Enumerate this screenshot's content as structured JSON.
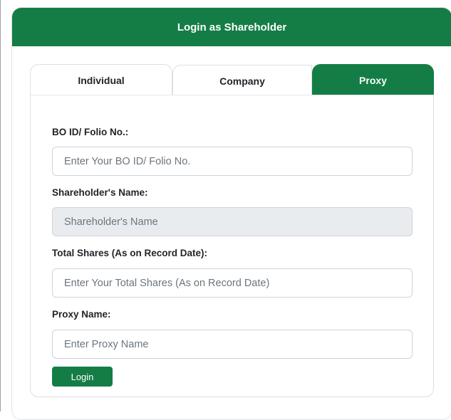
{
  "header": {
    "title": "Login as Shareholder"
  },
  "tabs": [
    {
      "label": "Individual",
      "active": false
    },
    {
      "label": "Company",
      "active": false
    },
    {
      "label": "Proxy",
      "active": true
    }
  ],
  "form": {
    "bo_id": {
      "label": "BO ID/ Folio No.:",
      "placeholder": "Enter Your BO ID/ Folio No.",
      "value": ""
    },
    "shareholder_name": {
      "label": "Shareholder's Name:",
      "placeholder": "Shareholder's Name",
      "value": "",
      "readonly": true
    },
    "total_shares": {
      "label": "Total Shares (As on Record Date):",
      "placeholder": "Enter Your Total Shares (As on Record Date)",
      "value": ""
    },
    "proxy_name": {
      "label": "Proxy Name:",
      "placeholder": "Enter Proxy Name",
      "value": ""
    },
    "login_label": "Login"
  },
  "colors": {
    "brand_green": "#147d46",
    "readonly_bg": "#e9ecef",
    "border": "#ced4da"
  }
}
